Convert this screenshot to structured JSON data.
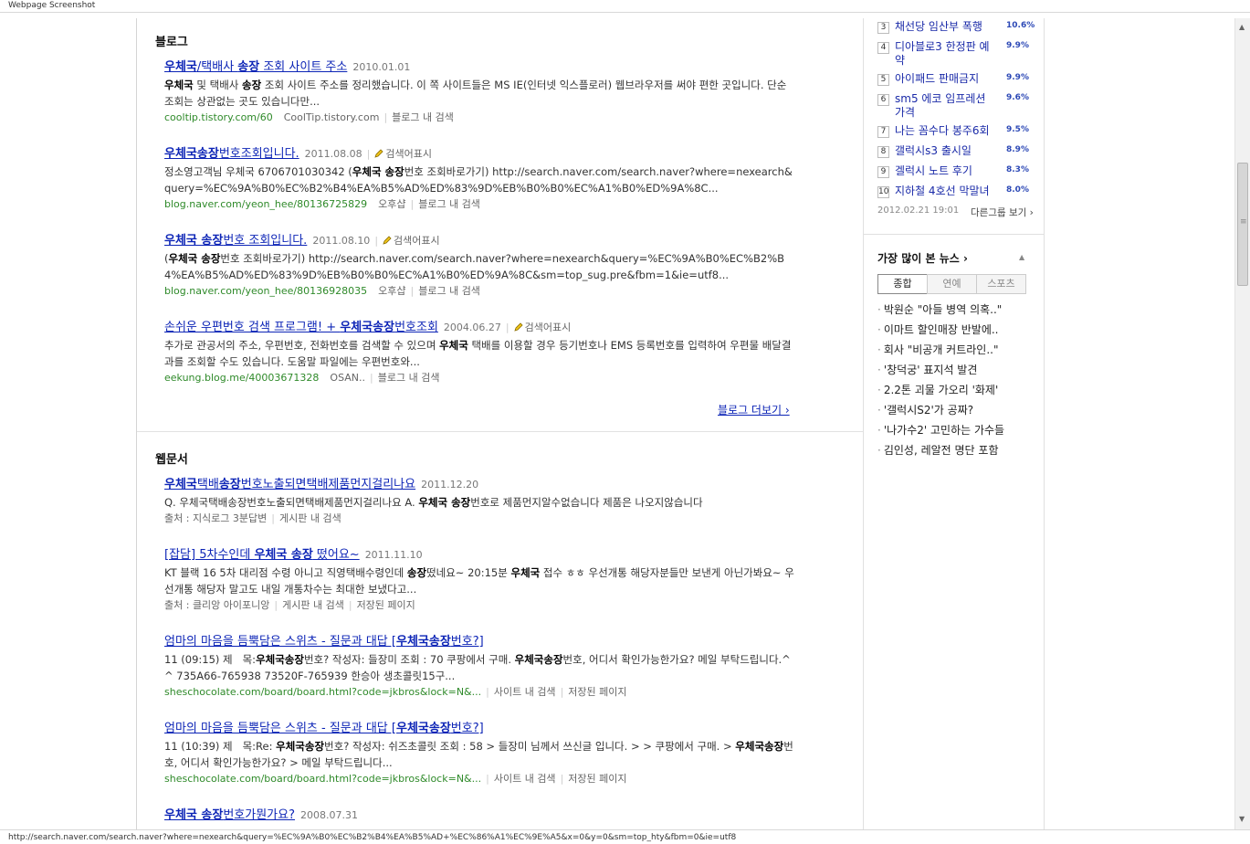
{
  "window": {
    "title": "Webpage Screenshot"
  },
  "status_bar": {
    "url": "http://search.naver.com/search.naver?where=nexearch&query=%EC%9A%B0%EC%B2%B4%EA%B5%AD+%EC%86%A1%EC%9E%A5&x=0&y=0&sm=top_hty&fbm=0&ie=utf8"
  },
  "blog": {
    "section_title": "블로그",
    "more_label": "블로그 더보기 ›",
    "results": [
      {
        "title_html": "<b>우체국</b>/택배사 <b>송장</b> 조회 사이트 주소",
        "date": "2010.01.01",
        "tag": "",
        "desc_html": "<b>우체국</b> 및 택배사 <b>송장</b> 조회 사이트 주소를 정리했습니다. 이 쪽 사이트들은 MS IE(인터넷 익스플로러) 웹브라우저를 써야 편한 곳입니다. 단순 조회는 상관없는 곳도 있습니다만...",
        "url": "cooltip.tistory.com/60",
        "source": "CoolTip.tistory.com",
        "action": "블로그 내 검색"
      },
      {
        "title_html": "<b>우체국송장</b>번호조회입니다.",
        "date": "2011.08.08",
        "tag": "검색어표시",
        "desc_html": "정소영고객님 우체국 6706701030342 (<b>우체국 송장</b>번호 조회바로가기) http://search.naver.com/search.naver?where=nexearch&amp;query=%EC%9A%B0%EC%B2%B4%EA%B5%AD%ED%83%9D%EB%B0%B0%EC%A1%B0%ED%9A%8C...",
        "url": "blog.naver.com/yeon_hee/80136725829",
        "source": "오후샵",
        "action": "블로그 내 검색"
      },
      {
        "title_html": "<b>우체국 송장</b>번호 조회입니다.",
        "date": "2011.08.10",
        "tag": "검색어표시",
        "desc_html": "(<b>우체국 송장</b>번호 조회바로가기) http://search.naver.com/search.naver?where=nexearch&amp;query=%EC%9A%B0%EC%B2%B4%EA%B5%AD%ED%83%9D%EB%B0%B0%EC%A1%B0%ED%9A%8C&amp;sm=top_sug.pre&amp;fbm=1&amp;ie=utf8...",
        "url": "blog.naver.com/yeon_hee/80136928035",
        "source": "오후샵",
        "action": "블로그 내 검색"
      },
      {
        "title_html": "손쉬운 우편번호 검색 프로그램! + <b>우체국송장</b>번호조회",
        "date": "2004.06.27",
        "tag": "검색어표시",
        "desc_html": "추가로 관공서의 주소, 우편번호, 전화번호를 검색할 수 있으며 <b>우체국</b> 택배를 이용할 경우 등기번호나 EMS 등록번호를 입력하여 우편물 배달결과를 조회할 수도 있습니다. 도움말 파일에는 우편번호와...",
        "url": "eekung.blog.me/40003671328",
        "source": "OSAN..",
        "action": "블로그 내 검색"
      }
    ]
  },
  "webdoc": {
    "section_title": "웹문서",
    "results": [
      {
        "title_html": "<b>우체국</b>택배<b>송장</b>번호노출되면택배제품먼지걸리나요",
        "date": "2011.12.20",
        "desc_html": "Q. 우체국택배송장번호노출되면택배제품먼지걸리나요 A. <b>우체국 송장</b>번호로 제품먼지알수없습니다 제품은 나오지않습니다",
        "meta": [
          "출처 : 지식로그 3분답변",
          "게시판 내 검색"
        ],
        "url": ""
      },
      {
        "title_html": "[잡담] 5차수인데 <b>우체국 송장</b> 떴어요~",
        "date": "2011.11.10",
        "desc_html": "KT 블랙 16 5차 대리점 수령 아니고 직영택배수령인데 <b>송장</b>떴네요~ 20:15분 <b>우체국</b> 접수 ㅎㅎ 우선개통 해당자분들만 보낸게 아닌가봐요~ 우선개통 해당자 말고도 내일 개통차수는 최대한 보냈다고...",
        "meta": [
          "출처 : 클리앙 아이포니앙",
          "게시판 내 검색",
          "저장된 페이지"
        ],
        "url": ""
      },
      {
        "title_html": "엄마의 마음을 듬뿍담은 스위츠 - 질문과 대답 [<b>우체국송장</b>번호?]",
        "date": "",
        "desc_html": "11 (09:15) 제 &nbsp; 목:<b>우체국송장</b>번호? 작성자: 들장미 조회 : 70 쿠팡에서 구매. <b>우체국송장</b>번호, 어디서 확인가능한가요? 메일 부탁드립니다.^^ 735A66-765938 73520F-765939 한승아 생초콜릿15구...",
        "meta": [
          "사이트 내 검색",
          "저장된 페이지"
        ],
        "url": "sheschocolate.com/board/board.html?code=jkbros&lock=N&..."
      },
      {
        "title_html": "엄마의 마음을 듬뿍담은 스위츠 - 질문과 대답 [<b>우체국송장</b>번호?]",
        "date": "",
        "desc_html": "11 (10:39) 제 &nbsp; 목:Re: <b>우체국송장</b>번호? 작성자: 쉬즈초콜릿 조회 : 58 &gt; 들장미 님께서 쓰신글 입니다. &gt; &gt; 쿠팡에서 구매. &gt; <b>우체국송장</b>번호, 어디서 확인가능한가요? &gt; 메일 부탁드립니다...",
        "meta": [
          "사이트 내 검색",
          "저장된 페이지"
        ],
        "url": "sheschocolate.com/board/board.html?code=jkbros&lock=N&..."
      },
      {
        "title_html": "<b>우체국 송장</b>번호가뭔가요?",
        "date": "2008.07.31",
        "desc_html": "",
        "meta": [],
        "url": ""
      }
    ]
  },
  "sidebar": {
    "ranking": [
      {
        "rank": "3",
        "text": "채선당 임산부 폭행",
        "pct": "10.6%"
      },
      {
        "rank": "4",
        "text": "디아블로3 한정판 예약",
        "pct": "9.9%"
      },
      {
        "rank": "5",
        "text": "아이패드 판매금지",
        "pct": "9.9%"
      },
      {
        "rank": "6",
        "text": "sm5 에코 임프레션 가격",
        "pct": "9.6%"
      },
      {
        "rank": "7",
        "text": "나는 꼼수다 봉주6회",
        "pct": "9.5%"
      },
      {
        "rank": "8",
        "text": "갤럭시s3 출시일",
        "pct": "8.9%"
      },
      {
        "rank": "9",
        "text": "겔럭시 노트 후기",
        "pct": "8.3%"
      },
      {
        "rank": "10",
        "text": "지하철 4호선 막말녀",
        "pct": "8.0%"
      }
    ],
    "ranking_date": "2012.02.21 19:01",
    "other_rank_label": "다른그룹 보기 ›",
    "news_title": "가장 많이 본 뉴스 ›",
    "news_tabs": [
      "종합",
      "연예",
      "스포츠"
    ],
    "news_items": [
      "박원순 \"아들 병역 의혹..\"",
      "이마트 할인매장 반발에..",
      "회사 \"비공개 커트라인..\"",
      "'창덕궁' 표지석 발견",
      "2.2톤 괴물 가오리 '화제'",
      "'갤럭시S2'가 공짜?",
      "'나가수2' 고민하는 가수들",
      "김인성, 레알전 명단 포함"
    ]
  },
  "colors": {
    "link": "#0c24b6",
    "url_green": "#2f8a2a",
    "rank_pct": "#2d49b6"
  }
}
